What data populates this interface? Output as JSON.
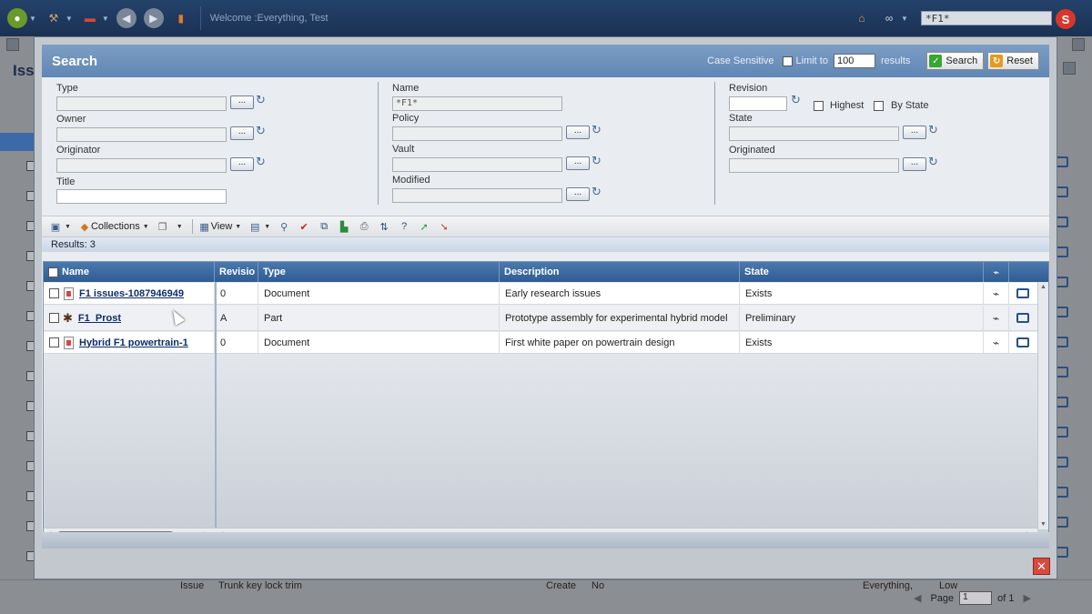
{
  "app": {
    "welcome": "Welcome :Everything, Test",
    "global_search_value": "*F1*",
    "logo_letter": "S"
  },
  "background": {
    "page_title": "Issu",
    "bottom_row": {
      "type": "Issue",
      "title": "Trunk key lock trim",
      "state": "Create",
      "flag": "No",
      "owner": "Everything,",
      "priority": "Low"
    },
    "pager": {
      "label": "Page",
      "current": "1",
      "total": "of 1"
    }
  },
  "search": {
    "title": "Search",
    "case_sensitive_label": "Case Sensitive",
    "limit_label": "Limit to",
    "limit_value": "100",
    "results_label": "results",
    "search_button": "Search",
    "reset_button": "Reset",
    "dots": "...",
    "fields": {
      "type": {
        "label": "Type",
        "value": ""
      },
      "owner": {
        "label": "Owner",
        "value": ""
      },
      "originator": {
        "label": "Originator",
        "value": ""
      },
      "title": {
        "label": "Title",
        "value": ""
      },
      "name": {
        "label": "Name",
        "value": "*F1*"
      },
      "policy": {
        "label": "Policy",
        "value": ""
      },
      "vault": {
        "label": "Vault",
        "value": ""
      },
      "modified": {
        "label": "Modified",
        "value": ""
      },
      "revision": {
        "label": "Revision",
        "value": ""
      },
      "highest": {
        "label": "Highest"
      },
      "by_state": {
        "label": "By State"
      },
      "state": {
        "label": "State",
        "value": ""
      },
      "originated": {
        "label": "Originated",
        "value": ""
      }
    }
  },
  "toolbar": {
    "collections": "Collections",
    "view": "View"
  },
  "results": {
    "summary": "Results: 3",
    "columns": [
      "Name",
      "Revisio",
      "Type",
      "Description",
      "State"
    ],
    "rows": [
      {
        "name": "F1 issues-1087946949",
        "revision": "0",
        "type": "Document",
        "description": "Early research issues",
        "state": "Exists",
        "kind": "doc"
      },
      {
        "name": "F1_Prost",
        "revision": "A",
        "type": "Part",
        "description": "Prototype assembly for experimental hybrid model",
        "state": "Preliminary",
        "kind": "part"
      },
      {
        "name": "Hybrid F1 powertrain-1",
        "revision": "0",
        "type": "Document",
        "description": "First white paper on powertrain design",
        "state": "Exists",
        "kind": "doc"
      }
    ]
  },
  "colors": {
    "header": "#5f86b4",
    "grid_header": "#2f5c93",
    "link": "#0d2d6b",
    "close": "#d84a3c"
  }
}
